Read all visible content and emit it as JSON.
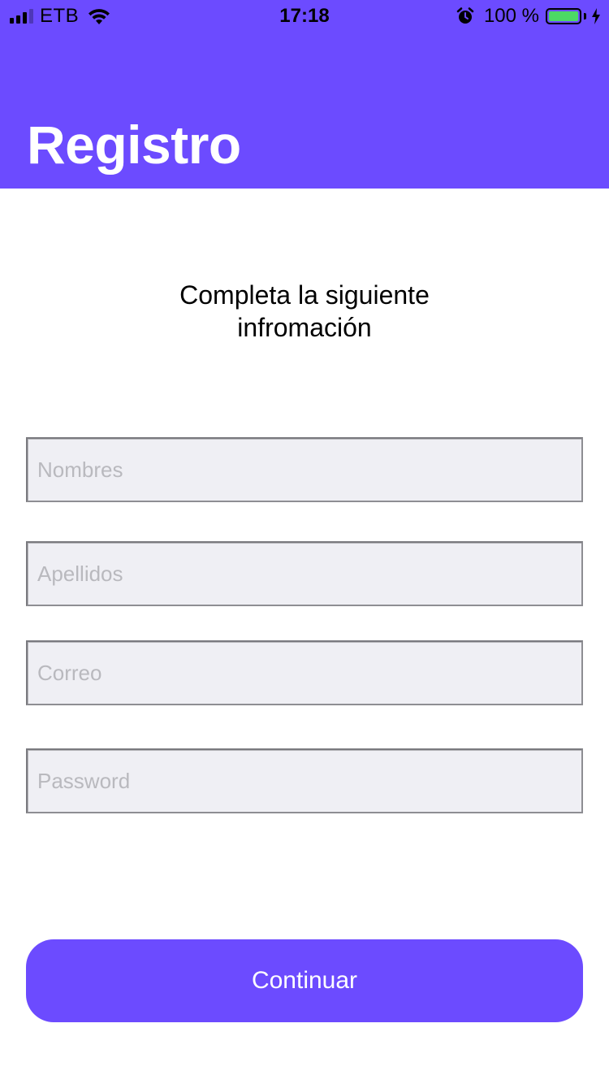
{
  "status_bar": {
    "carrier": "ETB",
    "time": "17:18",
    "battery_percent": "100 %",
    "signal_icon": "signal-bars-icon",
    "wifi_icon": "wifi-icon",
    "alarm_icon": "alarm-clock-icon",
    "battery_icon": "battery-icon",
    "charging_icon": "charging-bolt-icon",
    "battery_level": 1.0
  },
  "header": {
    "title": "Registro",
    "background_color": "#6c4bff"
  },
  "form": {
    "subtitle_line1": "Completa la siguiente",
    "subtitle_line2": "infromación",
    "fields": [
      {
        "placeholder": "Nombres",
        "value": ""
      },
      {
        "placeholder": "Apellidos",
        "value": ""
      },
      {
        "placeholder": "Correo",
        "value": ""
      },
      {
        "placeholder": "Password",
        "value": ""
      }
    ],
    "continue_label": "Continuar"
  },
  "colors": {
    "accent": "#6c4bff",
    "field_background": "#efeff4",
    "battery_green": "#4cd964"
  }
}
